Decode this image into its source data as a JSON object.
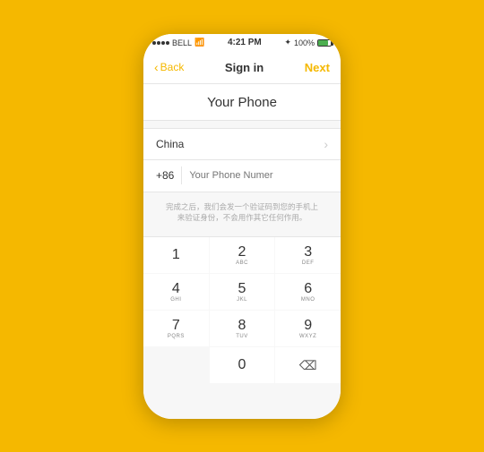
{
  "statusBar": {
    "carrier": "BELL",
    "time": "4:21 PM",
    "battery": "100%"
  },
  "navBar": {
    "backLabel": "Back",
    "title": "Sign in",
    "nextLabel": "Next"
  },
  "page": {
    "title": "Your Phone",
    "country": "China",
    "countryCode": "+86",
    "phonePlaceholder": "Your Phone Numer",
    "infoText": "完成之后，我们会发一个验证码到您的手机上\n来验证身份，不会用作其它任何作用。"
  },
  "keypad": {
    "keys": [
      {
        "num": "1",
        "letters": ""
      },
      {
        "num": "2",
        "letters": "ABC"
      },
      {
        "num": "3",
        "letters": "DEF"
      },
      {
        "num": "4",
        "letters": "GHI"
      },
      {
        "num": "5",
        "letters": "JKL"
      },
      {
        "num": "6",
        "letters": "MNO"
      },
      {
        "num": "7",
        "letters": "PQRS"
      },
      {
        "num": "8",
        "letters": "TUV"
      },
      {
        "num": "9",
        "letters": "WXYZ"
      },
      {
        "num": "0",
        "letters": ""
      }
    ]
  }
}
